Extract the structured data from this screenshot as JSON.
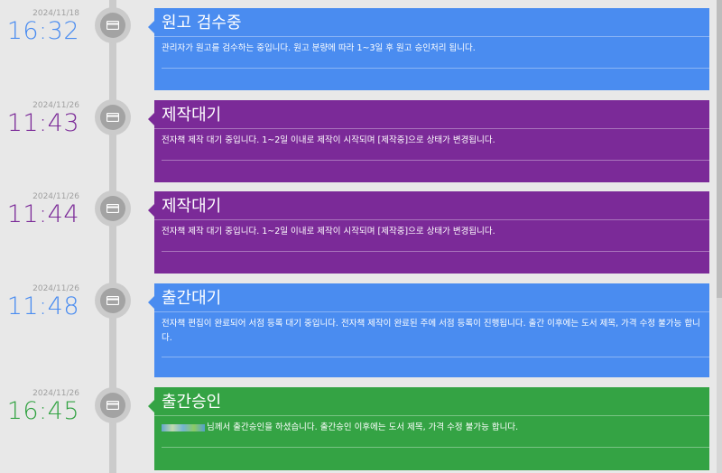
{
  "entries": [
    {
      "date": "2024/11/18",
      "time": "16:32",
      "title": "원고 검수중",
      "body": "관리자가 원고를 검수하는 중입니다. 원고 분량에 따라 1~3일 후 원고 승인처리 됩니다.",
      "color": "#4a8cf0",
      "icon": "credit-card-icon"
    },
    {
      "date": "2024/11/26",
      "time": "11:43",
      "title": "제작대기",
      "body": "전자책 제작 대기 중입니다. 1~2일 이내로 제작이 시작되며 [제작중]으로 상태가 변경됩니다.",
      "color": "#7b2a98",
      "icon": "credit-card-icon"
    },
    {
      "date": "2024/11/26",
      "time": "11:44",
      "title": "제작대기",
      "body": "전자책 제작 대기 중입니다. 1~2일 이내로 제작이 시작되며 [제작중]으로 상태가 변경됩니다.",
      "color": "#7b2a98",
      "icon": "credit-card-icon"
    },
    {
      "date": "2024/11/26",
      "time": "11:48",
      "title": "출간대기",
      "body": "전자책 편집이 완료되어 서점 등록 대기 중입니다. 전자책 제작이 완료된 주에 서점 등록이 진행됩니다. 출간 이후에는 도서 제목, 가격 수정 불가능 합니다.",
      "color": "#4a8cf0",
      "icon": "credit-card-icon"
    },
    {
      "date": "2024/11/26",
      "time": "16:45",
      "title": "출간승인",
      "body": "님께서 출간승인을 하셨습니다. 출간승인 이후에는 도서 제목, 가격 수정 불가능 합니다.",
      "color": "#34a344",
      "icon": "credit-card-icon"
    }
  ]
}
